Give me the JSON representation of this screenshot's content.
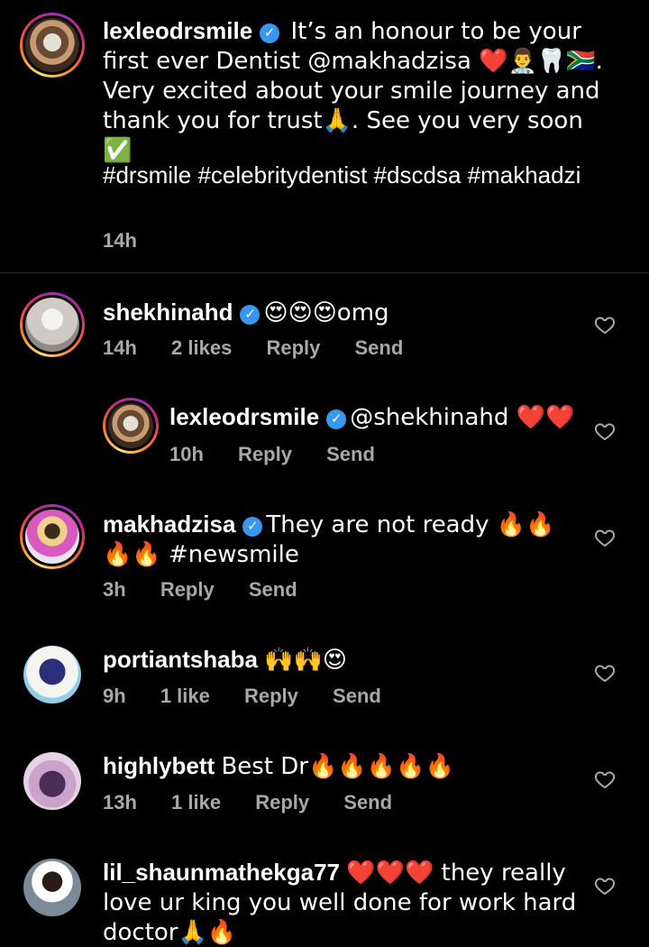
{
  "caption": {
    "username": "lexleodrsmile",
    "text_1": " It’s an honour to be your first ever Dentist @makhadzisa ❤️👨‍⚕️🦷🇿🇦. Very excited about your smile journey and thank you for trust🙏. See you very soon ✅",
    "hashtags": "#drsmile #celebritydentist #dscdsa #makhadzi",
    "time": "14h"
  },
  "comments": [
    {
      "username": "shekhinahd",
      "text": "😍😍😍omg",
      "time": "14h",
      "likes": "2 likes",
      "reply": "Reply",
      "send": "Send"
    },
    {
      "username": "lexleodrsmile",
      "text": "@shekhinahd ❤️❤️",
      "time": "10h",
      "reply": "Reply",
      "send": "Send"
    },
    {
      "username": "makhadzisa",
      "text": "They are not ready 🔥🔥🔥🔥 #newsmile",
      "time": "3h",
      "reply": "Reply",
      "send": "Send"
    },
    {
      "username": "portiantshaba",
      "text": "🙌🙌😍",
      "time": "9h",
      "likes": "1 like",
      "reply": "Reply",
      "send": "Send"
    },
    {
      "username": "highlybett",
      "text": "Best Dr🔥🔥🔥🔥🔥",
      "time": "13h",
      "likes": "1 like",
      "reply": "Reply",
      "send": "Send"
    },
    {
      "username": "lil_shaunmathekga77",
      "text": "❤️❤️❤️ they really love ur king you well done for work  hard doctor🙏🔥"
    }
  ],
  "colors": {
    "background": "#000000",
    "text": "#ffffff",
    "meta": "#a8a8a8",
    "verified": "#3897f0",
    "divider": "#262626"
  },
  "icons": {
    "verified": "verified-badge-icon",
    "like": "heart-outline-icon"
  }
}
